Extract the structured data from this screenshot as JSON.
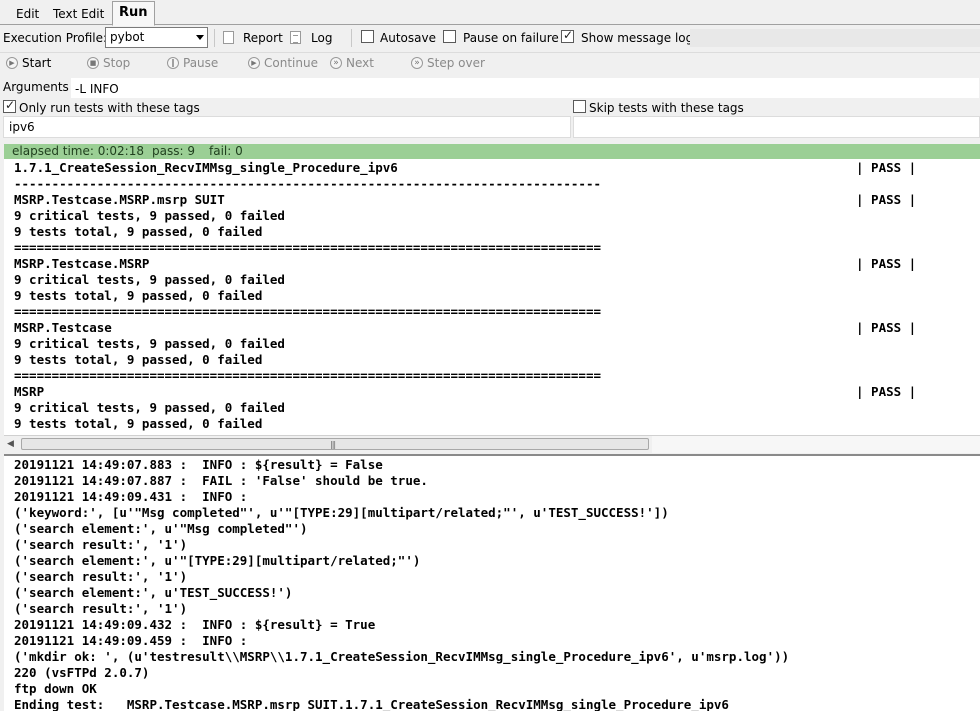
{
  "tabs": [
    "Edit",
    "Text Edit",
    "Run"
  ],
  "profile": {
    "label": "Execution Profile:",
    "value": "pybot",
    "report": "Report",
    "log": "Log",
    "autosave": "Autosave",
    "pause_on_failure": "Pause on failure",
    "show_message_log": "Show message log"
  },
  "controls": {
    "start": "Start",
    "stop": "Stop",
    "pause": "Pause",
    "continue": "Continue",
    "next": "Next",
    "step_over": "Step over"
  },
  "arguments": {
    "label": "Arguments:",
    "value": "-L INFO"
  },
  "tags": {
    "only_run_label": "Only run tests with these tags",
    "only_run_value": "ipv6",
    "only_run_checked": true,
    "skip_label": "Skip tests with these tags",
    "skip_checked": false
  },
  "status": {
    "elapsed": "elapsed time: 0:02:18",
    "pass": "pass: 9",
    "fail": "fail: 0"
  },
  "output_lines": [
    {
      "text": "1.7.1_CreateSession_RecvIMMsg_single_Procedure_ipv6",
      "status": "| PASS |"
    },
    {
      "text": "------------------------------------------------------------------------------",
      "status": ""
    },
    {
      "text": "MSRP.Testcase.MSRP.msrp SUIT",
      "status": "| PASS |"
    },
    {
      "text": "9 critical tests, 9 passed, 0 failed",
      "status": ""
    },
    {
      "text": "9 tests total, 9 passed, 0 failed",
      "status": ""
    },
    {
      "text": "==============================================================================",
      "status": ""
    },
    {
      "text": "MSRP.Testcase.MSRP",
      "status": "| PASS |"
    },
    {
      "text": "9 critical tests, 9 passed, 0 failed",
      "status": ""
    },
    {
      "text": "9 tests total, 9 passed, 0 failed",
      "status": ""
    },
    {
      "text": "==============================================================================",
      "status": ""
    },
    {
      "text": "MSRP.Testcase",
      "status": "| PASS |"
    },
    {
      "text": "9 critical tests, 9 passed, 0 failed",
      "status": ""
    },
    {
      "text": "9 tests total, 9 passed, 0 failed",
      "status": ""
    },
    {
      "text": "==============================================================================",
      "status": ""
    },
    {
      "text": "MSRP",
      "status": "| PASS |"
    },
    {
      "text": "9 critical tests, 9 passed, 0 failed",
      "status": ""
    },
    {
      "text": "9 tests total, 9 passed, 0 failed",
      "status": ""
    }
  ],
  "log_lines": [
    "20191121 14:49:07.883 :  INFO : ${result} = False",
    "20191121 14:49:07.887 :  FAIL : 'False' should be true.",
    "20191121 14:49:09.431 :  INFO :",
    "('keyword:', [u'\"Msg completed\"', u'\"[TYPE:29][multipart/related;\"', u'TEST_SUCCESS!'])",
    "('search element:', u'\"Msg completed\"')",
    "('search result:', '1')",
    "('search element:', u'\"[TYPE:29][multipart/related;\"')",
    "('search result:', '1')",
    "('search element:', u'TEST_SUCCESS!')",
    "('search result:', '1')",
    "20191121 14:49:09.432 :  INFO : ${result} = True",
    "20191121 14:49:09.459 :  INFO :",
    "('mkdir ok: ', (u'testresult\\\\MSRP\\\\1.7.1_CreateSession_RecvIMMsg_single_Procedure_ipv6', u'msrp.log'))",
    "220 (vsFTPd 2.0.7)",
    "ftp down OK",
    "Ending test:   MSRP.Testcase.MSRP.msrp SUIT.1.7.1_CreateSession_RecvIMMsg_single_Procedure_ipv6"
  ],
  "colors": {
    "status_bar": "#9bcf95",
    "background": "#f0f0f0"
  }
}
